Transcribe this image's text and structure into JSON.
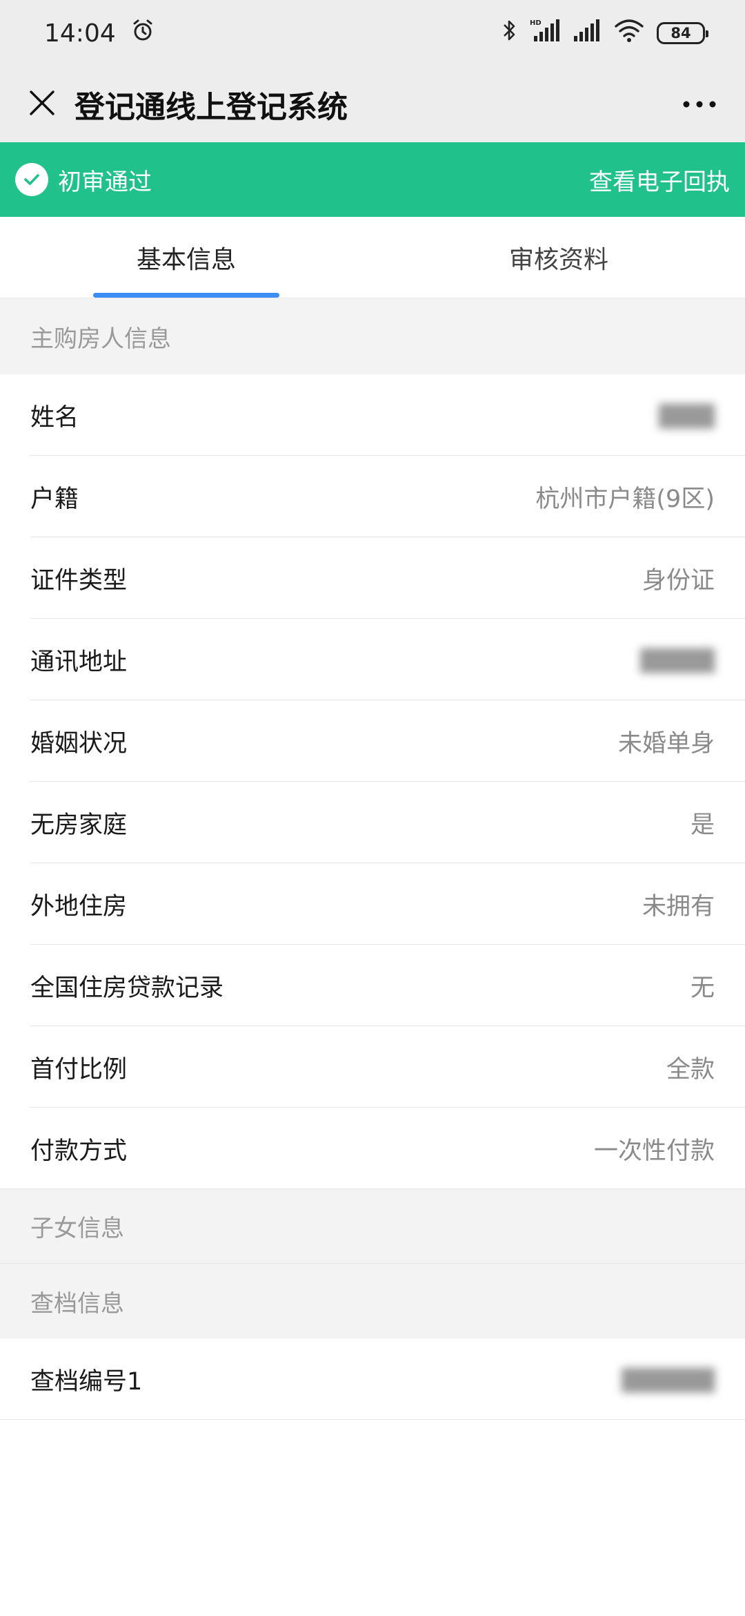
{
  "status_bar": {
    "time": "14:04",
    "battery": "84",
    "icons": [
      "alarm-icon",
      "bluetooth-icon",
      "hd-signal-icon",
      "signal-icon",
      "wifi-icon",
      "battery-icon"
    ]
  },
  "nav": {
    "title": "登记通线上登记系统",
    "close_icon": "close-icon",
    "more_icon": "more-icon"
  },
  "banner": {
    "status": "初审通过",
    "link": "查看电子回执",
    "color": "#21c18b"
  },
  "tabs": [
    {
      "label": "基本信息",
      "active": true
    },
    {
      "label": "审核资料",
      "active": false
    }
  ],
  "sections": {
    "buyer": {
      "title": "主购房人信息",
      "rows": [
        {
          "label": "姓名",
          "value": "",
          "blurred": true
        },
        {
          "label": "户籍",
          "value": "杭州市户籍(9区)"
        },
        {
          "label": "证件类型",
          "value": "身份证"
        },
        {
          "label": "通讯地址",
          "value": "",
          "blurred": true
        },
        {
          "label": "婚姻状况",
          "value": "未婚单身"
        },
        {
          "label": "无房家庭",
          "value": "是"
        },
        {
          "label": "外地住房",
          "value": "未拥有"
        },
        {
          "label": "全国住房贷款记录",
          "value": "无"
        },
        {
          "label": "首付比例",
          "value": "全款"
        },
        {
          "label": "付款方式",
          "value": "一次性付款"
        }
      ]
    },
    "children": {
      "title": "子女信息"
    },
    "archive": {
      "title": "查档信息",
      "rows": [
        {
          "label": "查档编号1",
          "value": "",
          "blurred": true
        }
      ]
    }
  },
  "accent_color": "#3c8ef5"
}
